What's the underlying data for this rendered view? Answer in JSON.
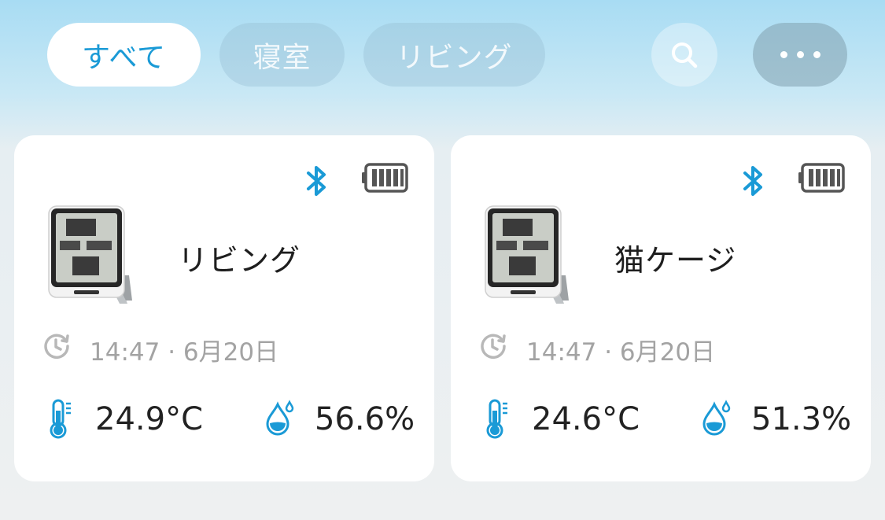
{
  "colors": {
    "accent": "#1a9ad6",
    "card_bg": "#ffffff",
    "muted_text": "#a3a3a3"
  },
  "filters": {
    "tabs": [
      {
        "label": "すべて",
        "active": true
      },
      {
        "label": "寝室",
        "active": false
      },
      {
        "label": "リビング",
        "active": false
      }
    ],
    "search_icon": "search-icon",
    "more_icon": "more-dots-icon"
  },
  "devices": [
    {
      "name": "リビング",
      "timestamp": "14:47 · 6月20日",
      "temperature": "24.9°C",
      "humidity": "56.6%",
      "bluetooth": true,
      "battery_level": 1.0
    },
    {
      "name": "猫ケージ",
      "timestamp": "14:47 · 6月20日",
      "temperature": "24.6°C",
      "humidity": "51.3%",
      "bluetooth": true,
      "battery_level": 1.0
    }
  ]
}
